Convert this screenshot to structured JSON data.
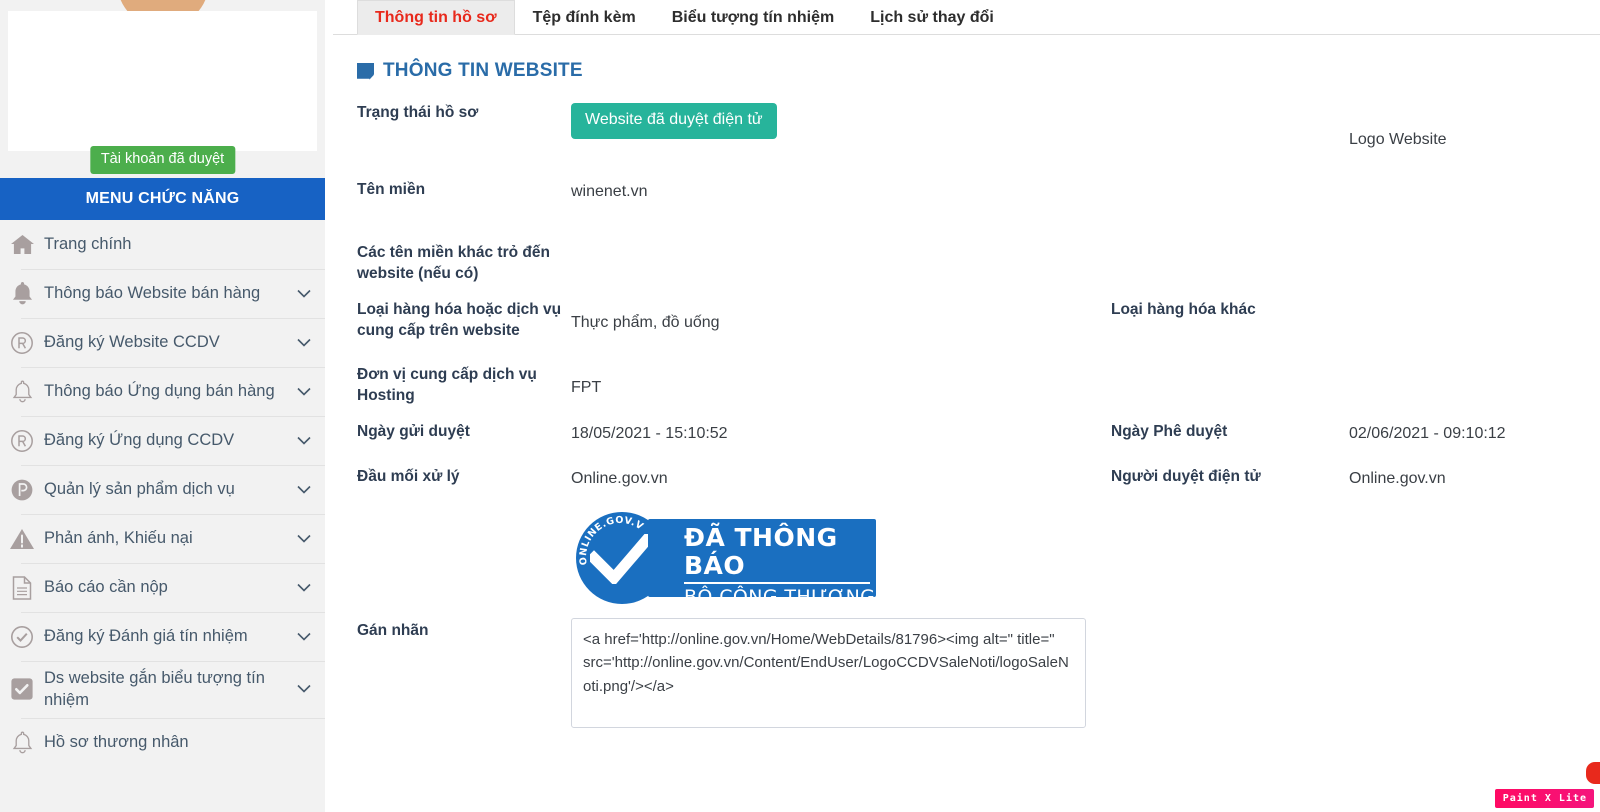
{
  "sidebar": {
    "account_badge": "Tài khoản đã duyệt",
    "menu_header": "MENU CHỨC NĂNG",
    "items": [
      {
        "label": "Trang chính",
        "icon": "home-icon",
        "caret": false
      },
      {
        "label": "Thông báo Website bán hàng",
        "icon": "bell-filled-icon",
        "caret": true
      },
      {
        "label": "Đăng ký Website CCDV",
        "icon": "registered-icon",
        "caret": true
      },
      {
        "label": "Thông báo Ứng dụng bán hàng",
        "icon": "bell-outline-icon",
        "caret": true
      },
      {
        "label": "Đăng ký Ứng dụng CCDV",
        "icon": "registered-icon",
        "caret": true
      },
      {
        "label": "Quản lý sản phẩm dịch vụ",
        "icon": "p-circle-icon",
        "caret": true
      },
      {
        "label": "Phản ánh, Khiếu nại",
        "icon": "warning-triangle-icon",
        "caret": true
      },
      {
        "label": "Báo cáo cần nộp",
        "icon": "document-icon",
        "caret": true
      },
      {
        "label": "Đăng ký Đánh giá tín nhiệm",
        "icon": "check-circle-icon",
        "caret": true
      },
      {
        "label": "Ds website gắn biểu tượng tín nhiệm",
        "icon": "checkbox-icon",
        "caret": true
      },
      {
        "label": "Hồ sơ thương nhân",
        "icon": "bell-outline-icon",
        "caret": false
      }
    ]
  },
  "tabs": [
    {
      "label": "Thông tin hồ sơ",
      "active": true
    },
    {
      "label": "Tệp đính kèm",
      "active": false
    },
    {
      "label": "Biểu tượng tín nhiệm",
      "active": false
    },
    {
      "label": "Lịch sử thay đổi",
      "active": false
    }
  ],
  "section": {
    "title": "THÔNG TIN WEBSITE"
  },
  "form": {
    "status_label": "Trạng thái hồ sơ",
    "status_value": "Website đã duyệt điện tử",
    "logo_website_label": "Logo Website",
    "domain_label": "Tên miền",
    "domain_value": "winenet.vn",
    "alias_label": "Các tên miền khác trỏ đến website (nếu có)",
    "alias_value": "",
    "goods_label": "Loại hàng hóa hoặc dịch vụ cung cấp trên website",
    "goods_value": "Thực phẩm, đồ uống",
    "goods_other_label": "Loại hàng hóa khác",
    "goods_other_value": "",
    "hosting_label": "Đơn vị cung cấp dịch vụ Hosting",
    "hosting_value": "FPT",
    "sent_date_label": "Ngày gửi duyệt",
    "sent_date_value": "18/05/2021 - 15:10:52",
    "approved_date_label": "Ngày Phê duyệt",
    "approved_date_value": "02/06/2021 - 09:10:12",
    "handler_label": "Đầu mối xử lý",
    "handler_value": "Online.gov.vn",
    "approver_label": "Người duyệt điện tử",
    "approver_value": "Online.gov.vn",
    "label_tag_label": "Gán nhãn",
    "label_code": "<a href='http://online.gov.vn/Home/WebDetails/81796><img alt=\" title=\" src='http://online.gov.vn/Content/EndUser/LogoCCDVSaleNoti/logoSaleNoti.png'/></a>"
  },
  "cert_badge": {
    "arc_text": "ONLINE.GOV.VN",
    "line1": "ĐÃ THÔNG BÁO",
    "line2": "BỘ CÔNG THƯƠNG"
  },
  "watermark": {
    "text": "Paint X Lite"
  },
  "colors": {
    "menu_header_blue": "#1762c4",
    "status_teal": "#27b49b",
    "account_green": "#4cae4c",
    "active_tab_red": "#e8291c",
    "section_title_blue": "#2a6ca8",
    "cert_blue": "#1a6fc0",
    "watermark_pink": "#ff0a63"
  }
}
